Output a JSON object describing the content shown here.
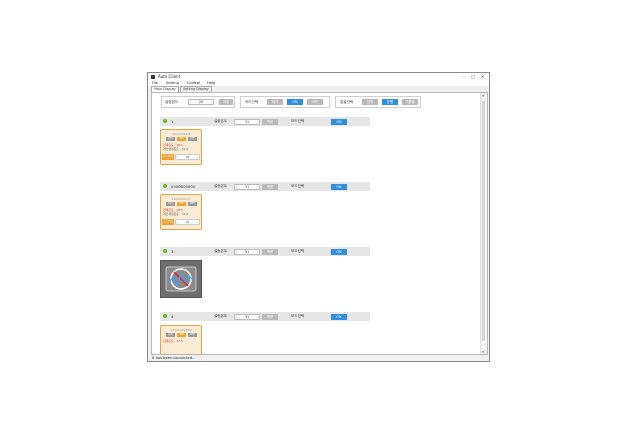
{
  "window": {
    "title": "Auto Client",
    "controls": {
      "minimize": "–",
      "maximize": "□",
      "close": "✕"
    }
  },
  "menu": [
    "File",
    "Setting",
    "Control",
    "Help"
  ],
  "tabs": [
    "Main Display",
    "Setting Display"
  ],
  "top_controls": {
    "temp_label": "설정온도",
    "temp_value": "20",
    "temp_apply": "적용",
    "mode_label": "모드선택",
    "mode_options": [
      "대기",
      "ON",
      "OFF"
    ],
    "wind_label": "일괄선택",
    "wind_options": [
      "전체",
      "운행",
      "그룹별"
    ]
  },
  "zones": [
    {
      "name": "1",
      "temp_label": "설정온도",
      "temp_value": "31",
      "apply": "적용",
      "mode_label": "모드선택",
      "mode_value": "ON",
      "card": {
        "id": "40242362M",
        "tags": [
          "대기",
          "ON",
          "OFF"
        ],
        "line1": "현재온도 : 28.5",
        "line2": "개인설정온도 : 31.0",
        "footer_label": "온도설정",
        "footer_value": "31"
      }
    },
    {
      "name": "2300000000",
      "temp_label": "설정온도",
      "temp_value": "31",
      "apply": "적용",
      "mode_label": "모드선택",
      "mode_value": "ON",
      "card": {
        "id": "2300000123",
        "tags": [
          "대기",
          "ON",
          "OFF"
        ],
        "line1": "현재온도 : 28.5",
        "line2": "개인설정온도 : 31.0",
        "footer_label": "온도설정",
        "footer_value": "31"
      }
    },
    {
      "name": "3",
      "temp_label": "설정온도",
      "temp_value": "31",
      "apply": "적용",
      "mode_label": "모드선택",
      "mode_value": "ON",
      "device_icon": "disconnected-sensor-icon"
    },
    {
      "name": "4",
      "temp_label": "설정온도",
      "temp_value": "31",
      "apply": "적용",
      "mode_label": "모드선택",
      "mode_value": "ON",
      "card": {
        "id": "02116362HE3",
        "tags": [
          "대기",
          "ON",
          "OFF"
        ],
        "line1": "현재온도 : 22.5",
        "line2": "",
        "footer_label": "",
        "footer_value": ""
      }
    }
  ],
  "status": "It has been connected...",
  "colors": {
    "accent": "#2e8fe0",
    "card_bg": "#fbecd6",
    "card_border": "#e9a44a",
    "zone_dot": "#6ab820",
    "on_tag": "#f0a030"
  }
}
